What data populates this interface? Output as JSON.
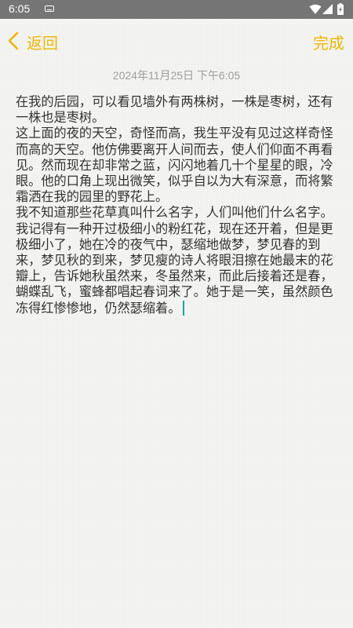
{
  "status_bar": {
    "time": "6:05"
  },
  "header": {
    "back_label": "返回",
    "done_label": "完成"
  },
  "note": {
    "timestamp": "2024年11月25日 下午6:05",
    "paragraphs": [
      "在我的后园，可以看见墙外有两株树，一株是枣树，还有一株也是枣树。",
      "这上面的夜的天空，奇怪而高，我生平没有见过这样奇怪而高的天空。他仿佛要离开人间而去，使人们仰面不再看见。然而现在却非常之蓝，闪闪地着几十个星星的眼，冷眼。他的口角上现出微笑，似乎自以为大有深意，而将繁霜洒在我的园里的野花上。",
      "我不知道那些花草真叫什么名字，人们叫他们什么名字。我记得有一种开过极细小的粉红花，现在还开着，但是更极细小了，她在冷的夜气中，瑟缩地做梦，梦见春的到来，梦见秋的到来，梦见瘦的诗人将眼泪擦在她最末的花瓣上，告诉她秋虽然来，冬虽然来，而此后接着还是春，蝴蝶乱飞，蜜蜂都唱起春词来了。她于是一笑，虽然颜色冻得红惨惨地，仍然瑟缩着。"
    ]
  },
  "colors": {
    "accent": "#f1b705",
    "status_bar": "#757575",
    "caret": "#1aa59a",
    "text": "#333333",
    "timestamp": "#9e9e9e"
  },
  "icons": {
    "status": [
      "keyboard-icon",
      "wifi-icon",
      "signal-icon",
      "battery-icon"
    ],
    "back": "chevron-left-icon"
  }
}
